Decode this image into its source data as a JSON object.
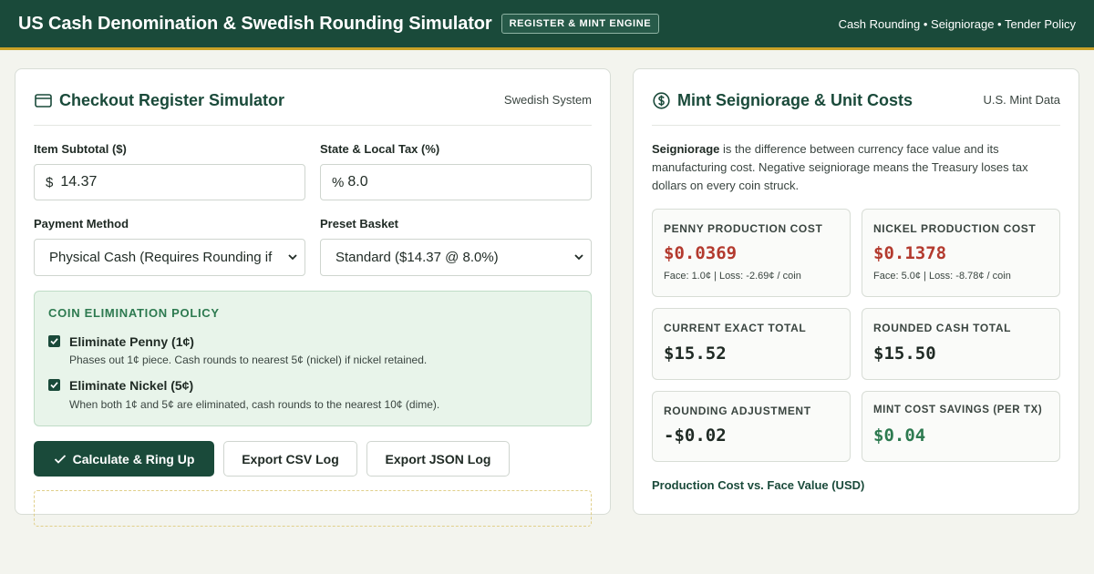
{
  "header": {
    "title": "US Cash Denomination & Swedish Rounding Simulator",
    "badge": "REGISTER & MINT ENGINE",
    "links": "Cash Rounding • Seigniorage • Tender Policy"
  },
  "register": {
    "title": "Checkout Register Simulator",
    "tag": "Swedish System",
    "subtotal_label": "Item Subtotal ($)",
    "subtotal_prefix": "$",
    "subtotal_value": "14.37",
    "tax_label": "State & Local Tax (%)",
    "tax_prefix": "%",
    "tax_value": "8.0",
    "payment_label": "Payment Method",
    "payment_value": "Physical Cash (Requires Rounding if",
    "basket_label": "Preset Basket",
    "basket_value": "Standard ($14.37 @ 8.0%)",
    "policy": {
      "title": "COIN ELIMINATION POLICY",
      "options": [
        {
          "label": "Eliminate Penny (1¢)",
          "desc": "Phases out 1¢ piece. Cash rounds to nearest 5¢ (nickel) if nickel retained.",
          "checked": true
        },
        {
          "label": "Eliminate Nickel (5¢)",
          "desc": "When both 1¢ and 5¢ are eliminated, cash rounds to the nearest 10¢ (dime).",
          "checked": true
        }
      ]
    },
    "buttons": {
      "calculate": "Calculate & Ring Up",
      "csv": "Export CSV Log",
      "json": "Export JSON Log"
    }
  },
  "mint": {
    "title": "Mint Seigniorage & Unit Costs",
    "tag": "U.S. Mint Data",
    "intro_term": "Seigniorage",
    "intro_rest": " is the difference between currency face value and its manufacturing cost. Negative seigniorage means the Treasury loses tax dollars on every coin struck.",
    "stats": [
      {
        "label": "PENNY PRODUCTION COST",
        "value": "$0.0369",
        "note": "Face: 1.0¢ | Loss: -2.69¢ / coin",
        "color": "#b33a2e"
      },
      {
        "label": "NICKEL PRODUCTION COST",
        "value": "$0.1378",
        "note": "Face: 5.0¢ | Loss: -8.78¢ / coin",
        "color": "#b33a2e"
      },
      {
        "label": "CURRENT EXACT TOTAL",
        "value": "$15.52",
        "color": "#1f2a24"
      },
      {
        "label": "ROUNDED CASH TOTAL",
        "value": "$15.50",
        "color": "#1f2a24"
      },
      {
        "label": "ROUNDING ADJUSTMENT",
        "value": "-$0.02",
        "color": "#1f2a24"
      },
      {
        "label": "MINT COST SAVINGS (PER TX)",
        "value": "$0.04",
        "color": "#2d7a50"
      }
    ],
    "chart_title": "Production Cost vs. Face Value (USD)"
  },
  "colors": {
    "brand": "#1a4a3a",
    "accent": "#c9a227",
    "loss": "#b33a2e",
    "gain": "#2d7a50"
  }
}
